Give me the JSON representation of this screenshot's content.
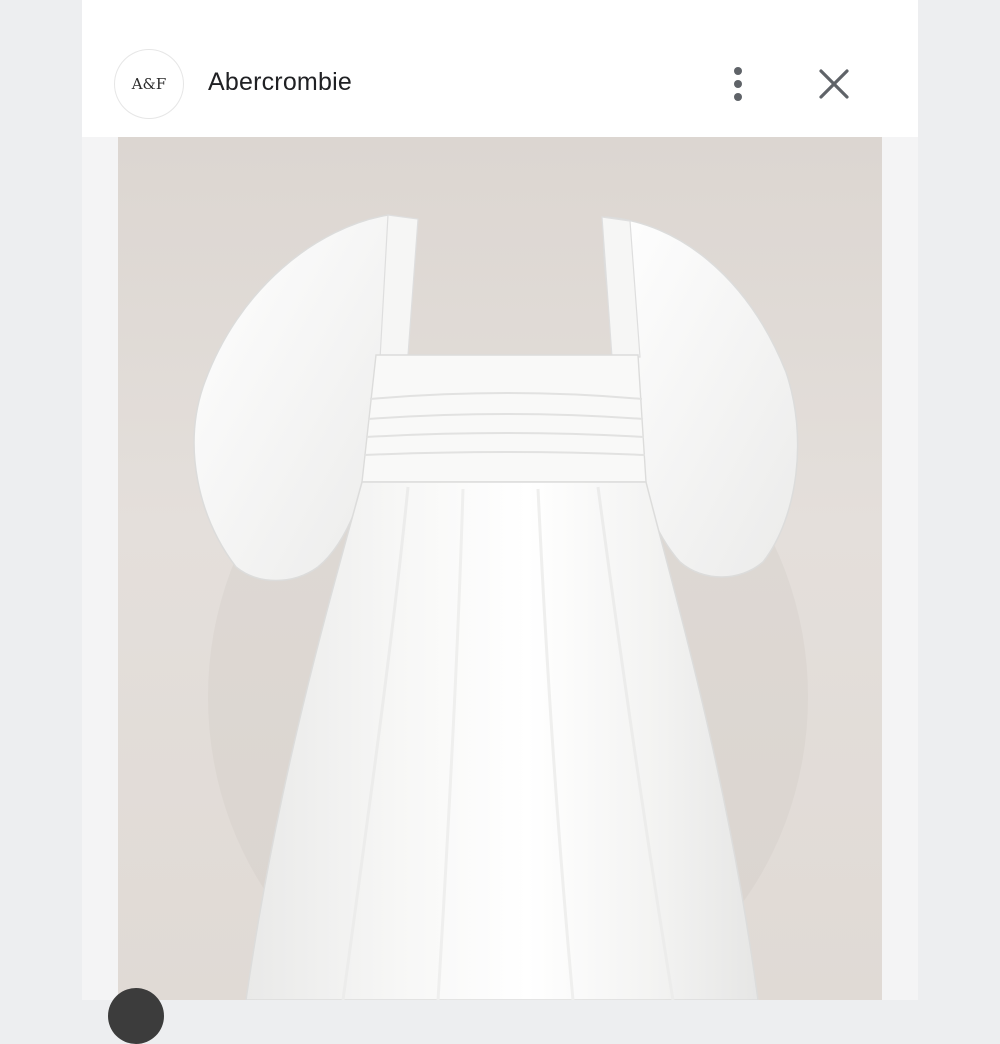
{
  "header": {
    "brand_name": "Abercrombie",
    "logo_text": "A&F",
    "more_icon": "more-vert-icon",
    "close_icon": "close-icon"
  },
  "image": {
    "subject": "dress-photo"
  },
  "colors": {
    "header_bg": "#ffffff",
    "photo_bg": "#e0dad5",
    "icon": "#5f6368"
  }
}
